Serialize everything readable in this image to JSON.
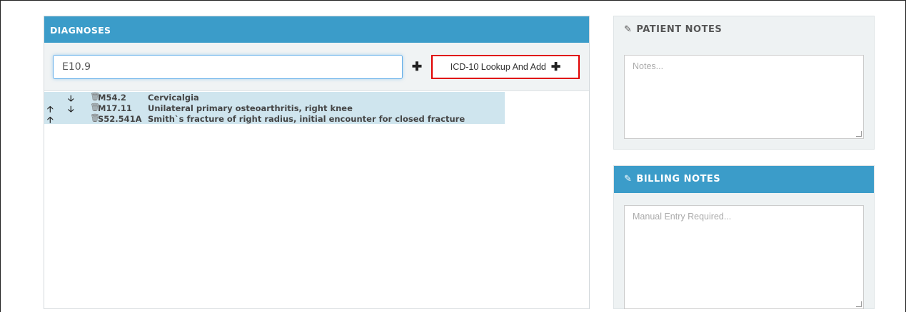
{
  "diagnoses": {
    "title": "DIAGNOSES",
    "input_value": "E10.9",
    "add_symbol": "✚",
    "lookup_label": "ICD-10 Lookup And Add",
    "lookup_plus": "✚",
    "items": [
      {
        "up": "",
        "down": "🡣",
        "trash": "🗑",
        "code": "M54.2",
        "description": "Cervicalgia"
      },
      {
        "up": "🡡",
        "down": "🡣",
        "trash": "🗑",
        "code": "M17.11",
        "description": "Unilateral primary osteoarthritis, right knee"
      },
      {
        "up": "🡡",
        "down": "",
        "trash": "🗑",
        "code": "S52.541A",
        "description": "Smith`s fracture of right radius, initial encounter for closed fracture"
      }
    ]
  },
  "patient_notes": {
    "icon": "✎",
    "title": "PATIENT NOTES",
    "placeholder": "Notes..."
  },
  "billing_notes": {
    "icon": "✎",
    "title": "BILLING NOTES",
    "placeholder": "Manual Entry Required..."
  },
  "colors": {
    "header_blue": "#3b9cc9",
    "row_highlight": "#cfe5ee",
    "lookup_border": "#e00000"
  }
}
